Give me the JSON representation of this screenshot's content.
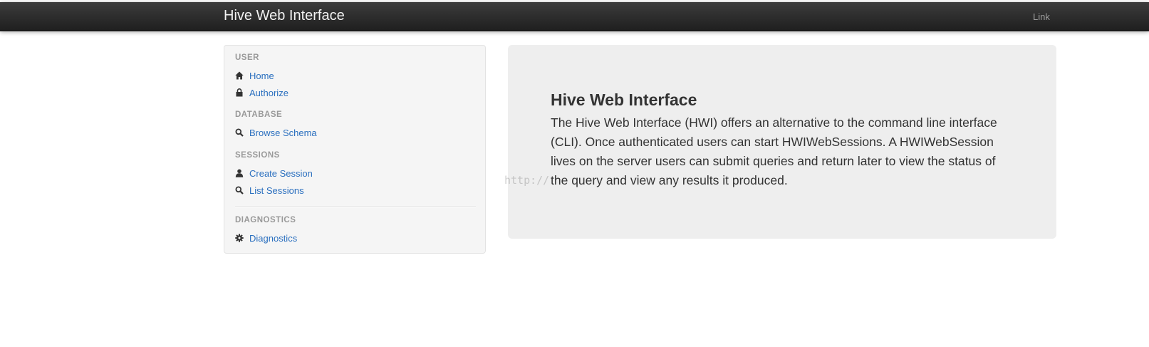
{
  "navbar": {
    "brand": "Hive Web Interface",
    "link": "Link"
  },
  "sidebar": {
    "sections": [
      {
        "header": "USER",
        "items": [
          {
            "label": "Home",
            "icon": "home-icon"
          },
          {
            "label": "Authorize",
            "icon": "lock-icon"
          }
        ]
      },
      {
        "header": "DATABASE",
        "items": [
          {
            "label": "Browse Schema",
            "icon": "search-icon"
          }
        ]
      },
      {
        "header": "SESSIONS",
        "items": [
          {
            "label": "Create Session",
            "icon": "user-icon"
          },
          {
            "label": "List Sessions",
            "icon": "search-icon"
          }
        ]
      },
      {
        "header": "DIAGNOSTICS",
        "items": [
          {
            "label": "Diagnostics",
            "icon": "cog-icon"
          }
        ]
      }
    ]
  },
  "hero": {
    "title": "Hive Web Interface",
    "text": "The Hive Web Interface (HWI) offers an alternative to the command line interface (CLI). Once authenticated users can start HWIWebSessions. A HWIWebSession lives on the server users can submit queries and return later to view the status of the query and view any results it produced."
  },
  "watermark": "http://",
  "colors": {
    "navbar": "#222222",
    "link": "#2a6fbf",
    "hero_bg": "#eeeeee",
    "sidebar_bg": "#f5f5f5"
  }
}
